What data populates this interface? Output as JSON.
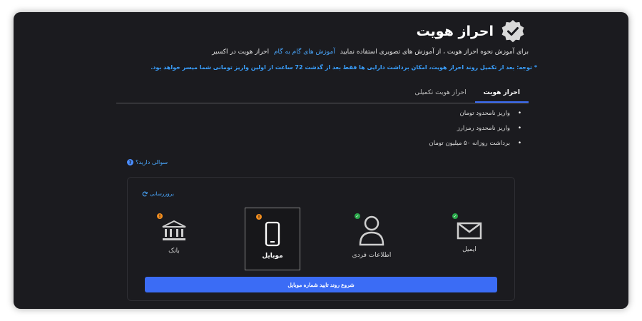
{
  "header": {
    "title": "احراز هویت"
  },
  "intro": {
    "text_before": "برای آموزش نحوه احراز هویت ، از آموزش های تصویری استفاده نمایید",
    "link": "آموزش های گام به گام",
    "text_after": "احراز هویت در اکسیر"
  },
  "notice": "* توجه: بعد از تکمیل روند احراز هویت، امکان برداشت دارایی ها فقط بعد از گذشت 72 ساعت از اولین واریز تومانی شما میسر خواهد بود.",
  "tabs": [
    {
      "label": "احراز هویت",
      "active": true
    },
    {
      "label": "احراز هویت تکمیلی",
      "active": false
    }
  ],
  "features": [
    "واریز نامحدود تومان",
    "واریز نامحدود رمزارز",
    "برداشت روزانه ۵۰ میلیون تومان"
  ],
  "faq_link": "سوالی دارید؟",
  "refresh_link": "بروزرسانی",
  "cards": [
    {
      "label": "ایمیل",
      "icon": "envelope-icon",
      "status": "verified"
    },
    {
      "label": "اطلاعات فردی",
      "icon": "user-icon",
      "status": "verified"
    },
    {
      "label": "موبایل",
      "icon": "mobile-icon",
      "status": "pending",
      "selected": true
    },
    {
      "label": "بانک",
      "icon": "bank-icon",
      "status": "pending"
    }
  ],
  "action_button": "شروع روند تایید شماره موبایل",
  "colors": {
    "background": "#1b1b1f",
    "accent": "#3b6cf5",
    "link": "#4aa8ff",
    "warning": "#f08c1e",
    "success": "#2aa84a"
  }
}
